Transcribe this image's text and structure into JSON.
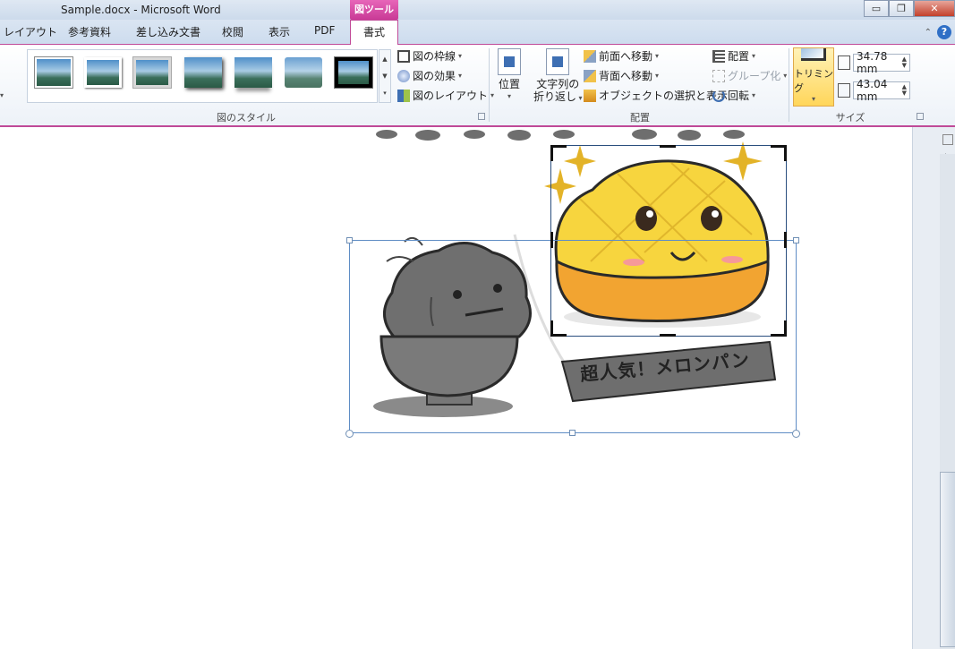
{
  "window": {
    "title": "Sample.docx - Microsoft Word",
    "contextual_group": "図ツール",
    "minimize_label": "▭",
    "restore_label": "❐",
    "close_label": "✕"
  },
  "tabs": [
    {
      "label": "レイアウト"
    },
    {
      "label": "参考資料"
    },
    {
      "label": "差し込み文書"
    },
    {
      "label": "校閲"
    },
    {
      "label": "表示"
    },
    {
      "label": "PDF"
    },
    {
      "label": "書式",
      "active": true
    }
  ],
  "ribbon": {
    "picture_styles": {
      "label": "図のスタイル",
      "border_cmd": "図の枠線",
      "effects_cmd": "図の効果",
      "layout_cmd": "図のレイアウト",
      "selected_style_index": 6
    },
    "arrange": {
      "label": "配置",
      "position_btn": "位置",
      "wrap_btn_line1": "文字列の",
      "wrap_btn_line2": "折り返し",
      "bring_forward": "前面へ移動",
      "send_backward": "背面へ移動",
      "selection_pane": "オブジェクトの選択と表示",
      "align": "配置",
      "group": "グループ化",
      "rotate": "回転"
    },
    "size": {
      "label": "サイズ",
      "crop_btn": "トリミング",
      "height_value": "34.78 mm",
      "width_value": "43.04 mm"
    }
  },
  "document": {
    "sign_text": "超人気！メロンパン"
  },
  "colors": {
    "accent_pink": "#c04a98",
    "crop_button_yellow": "#ffd65a"
  }
}
